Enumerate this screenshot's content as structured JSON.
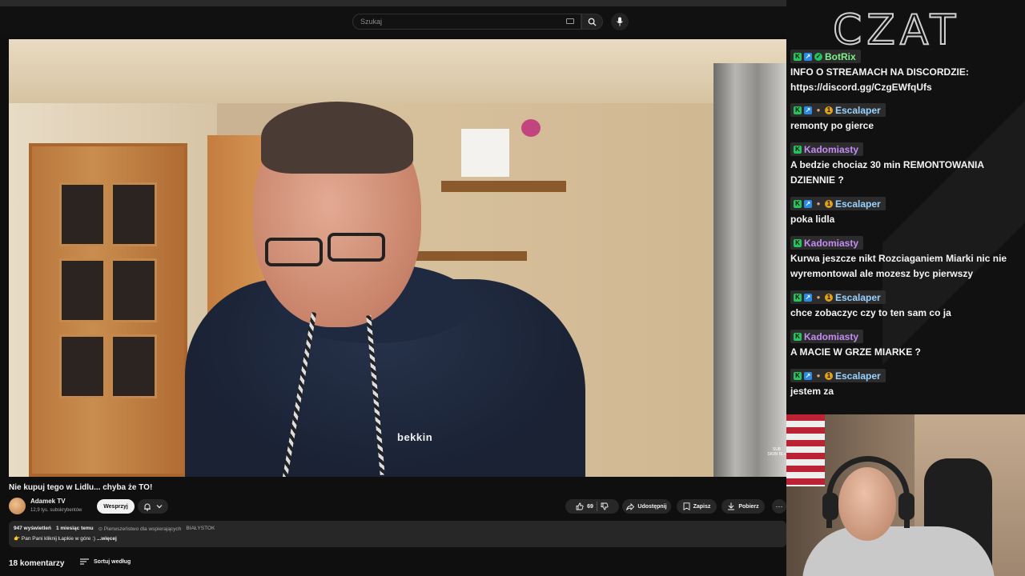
{
  "search": {
    "placeholder": "Szukaj"
  },
  "video": {
    "title": "Nie kupuj tego w Lidlu... chyba że TO!",
    "brand_logo": "bekkin",
    "corner_mark": "SUB SKIBI BL+"
  },
  "channel": {
    "name": "Adamek TV",
    "subscribers": "12,9 tys. subskrybentów",
    "support_label": "Wesprzyj"
  },
  "actions": {
    "likes": "69",
    "share_label": "Udostępnij",
    "save_label": "Zapisz",
    "download_label": "Pobierz"
  },
  "description": {
    "views": "947 wyświetleń",
    "date": "1 miesiąc temu",
    "priority": "⊙ Pierwszeństwo dla wspierających",
    "location": "BIAŁYSTOK",
    "snippet": "👉 Pan Pani kliknij Łapkie w góre :)",
    "more_label": "...więcej"
  },
  "comments": {
    "count_label": "18 komentarzy",
    "sort_label": "Sortuj według"
  },
  "chat": {
    "logo": "CZAT",
    "messages": [
      {
        "user": "BotRix",
        "text": "INFO O STREAMACH NA DISCORDZIE: https://discord.gg/CzgEWfqUfs"
      },
      {
        "user": "Escalaper",
        "text": "remonty po gierce"
      },
      {
        "user": "Kadomiasty",
        "text": "A bedzie chociaz 30 min REMONTOWANIA DZIENNIE ?"
      },
      {
        "user": "Escalaper",
        "text": "poka lidla"
      },
      {
        "user": "Kadomiasty",
        "text": "Kurwa jeszcze nikt Rozciaganiem Miarki nic nie wyremontowal ale mozesz byc pierwszy"
      },
      {
        "user": "Escalaper",
        "text": "chce zobaczyc czy to ten sam co ja"
      },
      {
        "user": "Kadomiasty",
        "text": "A MACIE W GRZE MIARKE ?"
      },
      {
        "user": "Escalaper",
        "text": "jestem za"
      }
    ]
  },
  "colors": {
    "background": "#0f0f0f",
    "chip": "#272727",
    "botrix_name": "#7cf08a",
    "escalaper_name": "#9ad2ff",
    "kadomiasty_name": "#c38cf5",
    "kick_badge": "#22c55e"
  },
  "icons": [
    "keyboard-icon",
    "search-icon",
    "mic-icon",
    "bell-icon",
    "chevron-down-icon",
    "thumbs-up-icon",
    "thumbs-down-icon",
    "share-icon",
    "save-icon",
    "download-icon",
    "more-icon",
    "sort-icon"
  ]
}
